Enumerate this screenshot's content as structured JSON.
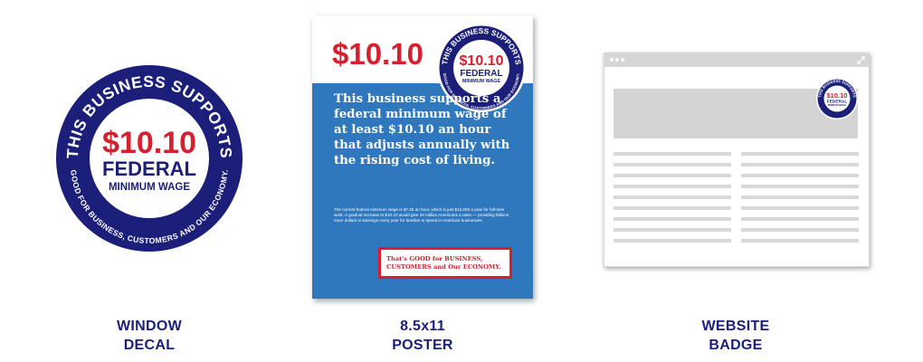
{
  "window_decal": {
    "arc_top": "THIS BUSINESS SUPPORTS",
    "arc_bottom": "GOOD FOR BUSINESS, CUSTOMERS AND OUR ECONOMY.",
    "price": "$10.10",
    "line1": "FEDERAL",
    "line2": "MINIMUM WAGE",
    "caption_line1": "WINDOW",
    "caption_line2": "DECAL"
  },
  "poster": {
    "price": "$10.10",
    "seal_arc_top": "THIS BUSINESS SUPPORTS",
    "seal_arc_bottom": "GOOD FOR BUSINESS, CUSTOMERS AND OUR ECONOMY.",
    "seal_price": "$10.10",
    "seal_line1": "FEDERAL",
    "seal_line2": "MINIMUM WAGE",
    "headline": "This business supports a federal minimum wage of at least $10.10 an hour that adjusts annually with the rising cost of living.",
    "body": "The current federal minimum wage is $7.25 an hour, which is just $15,000 a year for full-time work. A gradual increase to $10.10 would give 28 million Americans a raise — providing billions more dollars in earnings every year for families to spend in American businesses.",
    "footer": "That's GOOD for BUSINESS, CUSTOMERS and Our ECONOMY.",
    "caption_line1": "8.5x11",
    "caption_line2": "POSTER"
  },
  "website_badge": {
    "badge_arc_top": "THIS BUSINESS SUPPORTS",
    "badge_price": "$10.10",
    "badge_line1": "FEDERAL",
    "badge_line2": "MINIMUM WAGE",
    "caption_line1": "WEBSITE",
    "caption_line2": "BADGE"
  },
  "colors": {
    "navy": "#1b1f7a",
    "red": "#d4202f",
    "blue": "#2f78bd",
    "gray": "#d6d6d6"
  },
  "icons": [
    "window-dot-icon",
    "expand-icon"
  ]
}
